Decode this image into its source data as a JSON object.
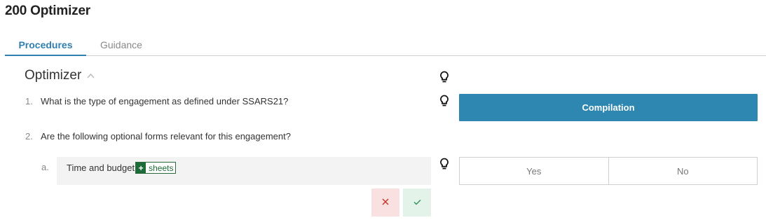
{
  "page": {
    "title": "200 Optimizer"
  },
  "tabs": [
    {
      "label": "Procedures",
      "active": true
    },
    {
      "label": "Guidance",
      "active": false
    }
  ],
  "section": {
    "title": "Optimizer"
  },
  "questions": [
    {
      "number": "1.",
      "text": "What is the type of engagement as defined under SSARS21?",
      "answer": "Compilation"
    },
    {
      "number": "2.",
      "text": "Are the following optional forms relevant for this engagement?"
    }
  ],
  "sub_question": {
    "letter": "a.",
    "text": "Time and budget",
    "tag": {
      "icon": "+",
      "label": "sheets"
    },
    "options": [
      "Yes",
      "No"
    ]
  },
  "actions": {
    "cancel_icon": "✕",
    "confirm_icon": "✓"
  },
  "colors": {
    "accent": "#2e87b0",
    "tag_green": "#1e6b3a",
    "cancel_bg": "#f9e1e1",
    "confirm_bg": "#e3f3ea"
  },
  "icons": {
    "hint": "lightbulb-icon",
    "collapse": "chevron-up-icon"
  }
}
